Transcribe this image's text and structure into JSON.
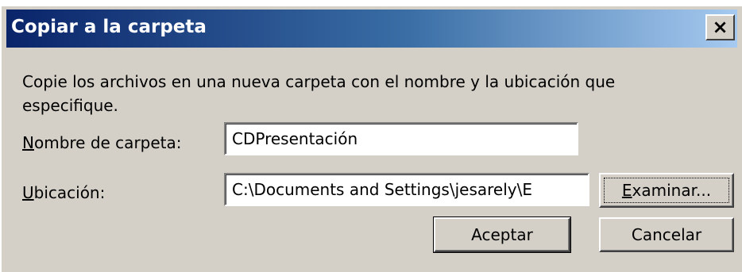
{
  "window": {
    "title": "Copiar a la carpeta",
    "close_label": "×",
    "description": "Copie los archivos en una nueva carpeta con el nombre y la ubicación que especifique."
  },
  "form": {
    "folder_name": {
      "label_accel": "N",
      "label_rest": "ombre de carpeta:",
      "value": "CDPresentación"
    },
    "location": {
      "label_accel": "U",
      "label_rest": "bicación:",
      "value": "C:\\Documents and Settings\\jesarely\\E"
    }
  },
  "buttons": {
    "browse_accel": "E",
    "browse_rest": "xaminar...",
    "ok": "Aceptar",
    "cancel": "Cancelar"
  }
}
